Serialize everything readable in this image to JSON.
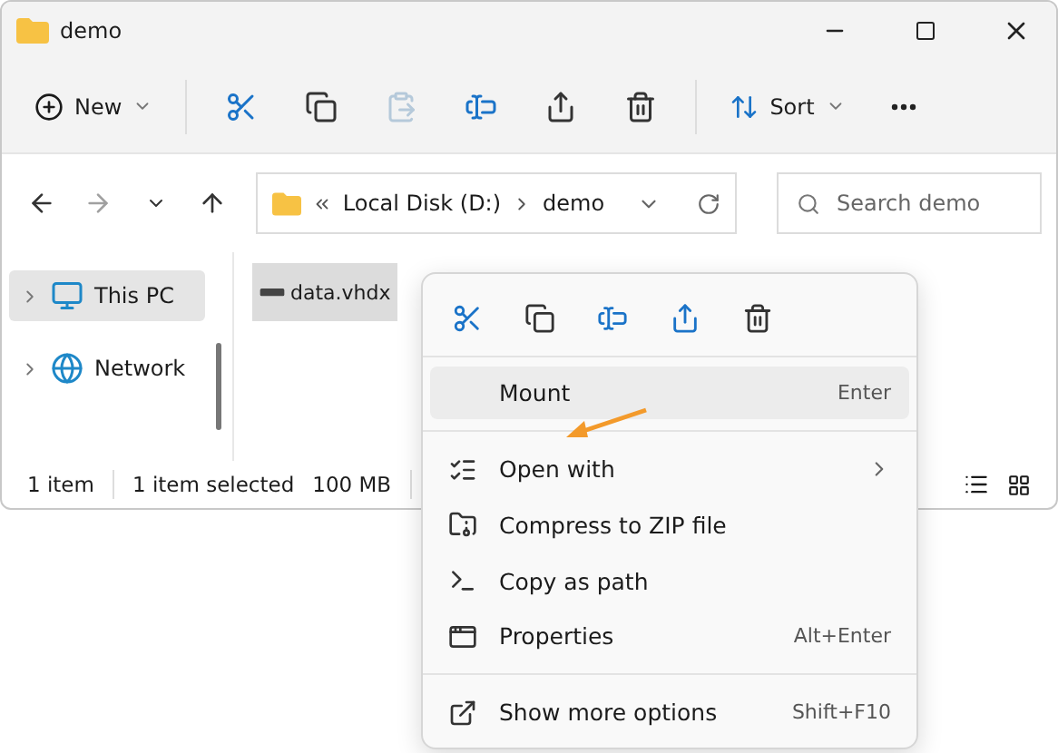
{
  "window": {
    "title": "demo"
  },
  "toolbar": {
    "new_label": "New",
    "actions": [
      {
        "disabled": false
      },
      {
        "disabled": false
      },
      {
        "disabled": true
      },
      {
        "disabled": false
      },
      {
        "disabled": false
      },
      {
        "disabled": false
      }
    ],
    "sort_label": "Sort"
  },
  "address": {
    "path": [
      {
        "label": "Local Disk (D:)"
      },
      {
        "label": "demo"
      }
    ],
    "search_placeholder": "Search demo"
  },
  "nav_pane": {
    "items": [
      {
        "label": "This PC",
        "selected": true
      },
      {
        "label": "Network",
        "selected": false
      }
    ]
  },
  "files": [
    {
      "name": "data.vhdx",
      "selected": true
    }
  ],
  "status_bar": {
    "count": "1 item",
    "selection": "1 item selected",
    "size": "100 MB"
  },
  "context_menu": {
    "actions": [
      {
        "disabled": false
      },
      {
        "disabled": false
      },
      {
        "disabled": false
      },
      {
        "disabled": false
      },
      {
        "disabled": false
      }
    ],
    "items": [
      {
        "kind": "item",
        "label": "Mount",
        "shortcut": "Enter",
        "highlighted": true,
        "submenu": false
      },
      {
        "kind": "separator"
      },
      {
        "kind": "item",
        "label": "Open with",
        "highlighted": false,
        "submenu": true
      },
      {
        "kind": "item",
        "label": "Compress to ZIP file",
        "highlighted": false,
        "submenu": false
      },
      {
        "kind": "item",
        "label": "Copy as path",
        "highlighted": false,
        "submenu": false
      },
      {
        "kind": "item",
        "label": "Properties",
        "shortcut": "Alt+Enter",
        "highlighted": false,
        "submenu": false
      },
      {
        "kind": "separator"
      },
      {
        "kind": "item",
        "label": "Show more options",
        "shortcut": "Shift+F10",
        "highlighted": false,
        "submenu": false
      }
    ]
  }
}
